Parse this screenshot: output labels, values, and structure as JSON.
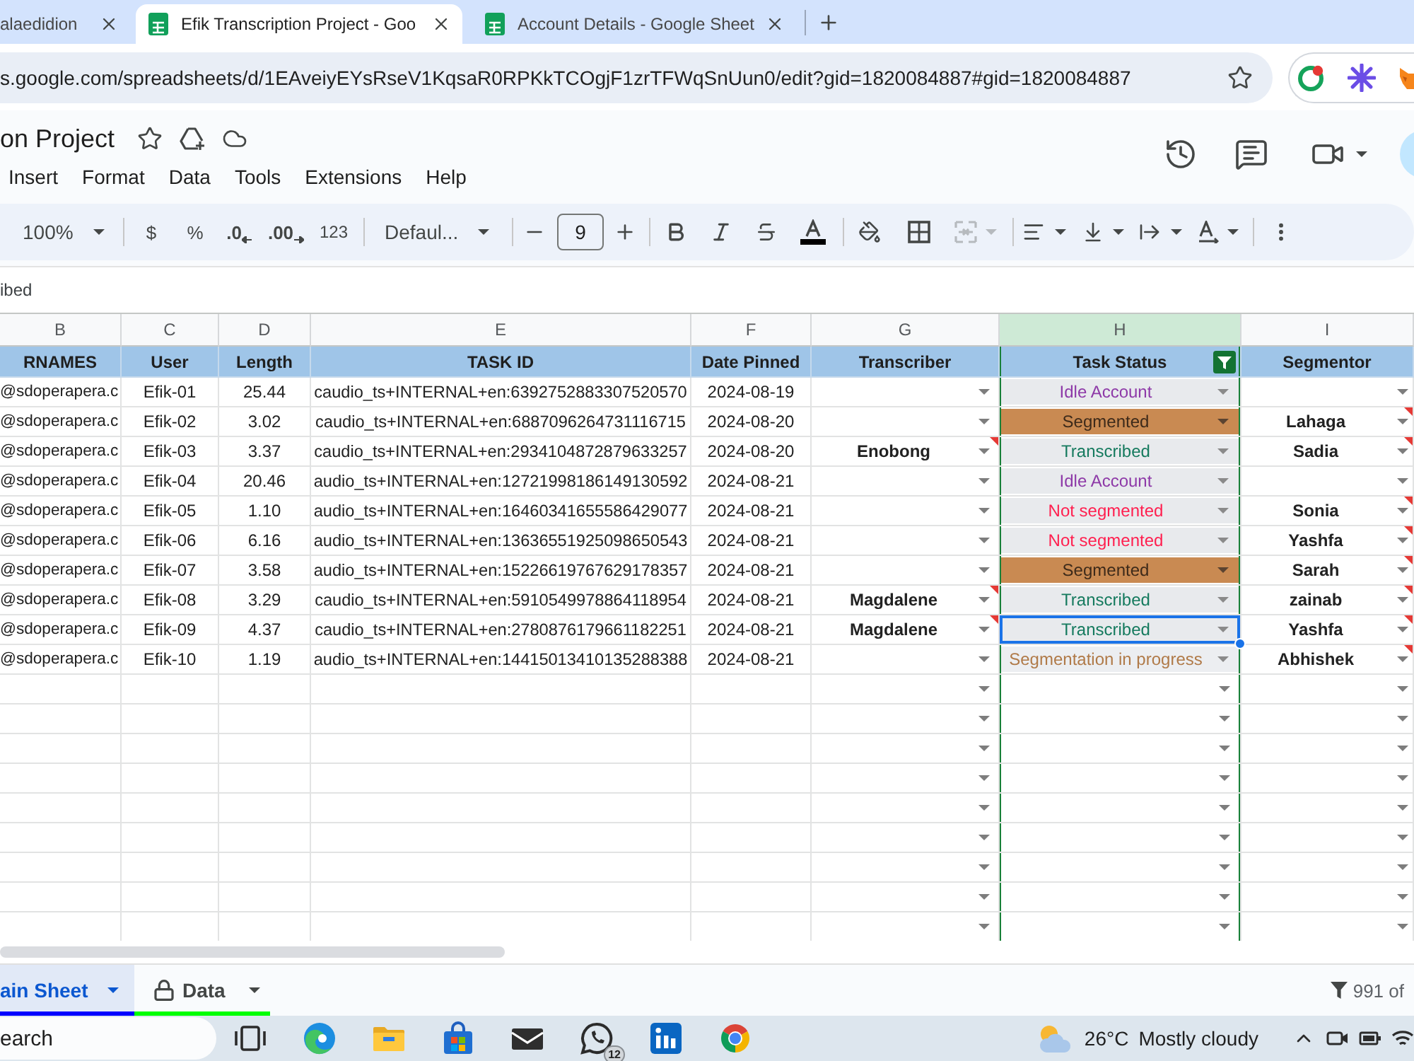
{
  "browser": {
    "tabs": [
      {
        "kind": "plain",
        "title": "alaedidion",
        "selected": false
      },
      {
        "kind": "sheet",
        "title": "Efik Transcription Project - Goo",
        "selected": true
      },
      {
        "kind": "sheet",
        "title": "Account Details - Google Sheet",
        "selected": false
      }
    ],
    "url": "s.google.com/spreadsheets/d/1EAveiyEYsRseV1KqsaR0RPKkTCOgjF1zrTFWqSnUun0/edit?gid=1820084887#gid=1820084887"
  },
  "document": {
    "title": "on Project",
    "menu": [
      "Insert",
      "Format",
      "Data",
      "Tools",
      "Extensions",
      "Help"
    ]
  },
  "toolbar": {
    "zoom": "100%",
    "currency": "$",
    "percent": "%",
    "decimals_less": ".0",
    "decimals_more": ".00",
    "number_format": "123",
    "font": "Defaul...",
    "font_size": "9",
    "merge": {
      "disabled": true
    }
  },
  "formula_bar": {
    "value": "ibed"
  },
  "sheet": {
    "columns": [
      {
        "letter": "B",
        "header": "RNAMES",
        "filtered": false
      },
      {
        "letter": "C",
        "header": "User",
        "filtered": false
      },
      {
        "letter": "D",
        "header": "Length",
        "filtered": false
      },
      {
        "letter": "E",
        "header": "TASK ID",
        "filtered": false
      },
      {
        "letter": "F",
        "header": "Date Pinned",
        "filtered": false
      },
      {
        "letter": "G",
        "header": "Transcriber",
        "filtered": false
      },
      {
        "letter": "H",
        "header": "Task Status",
        "filtered": true
      },
      {
        "letter": "I",
        "header": "Segmentor",
        "filtered": false
      }
    ],
    "rows": [
      {
        "kind": "data",
        "username": "@sdoperapera.c",
        "user": "Efik-01",
        "length": "25.44",
        "task_id": "caudio_ts+INTERNAL+en:6392752883307520570",
        "date_pinned": "2024-08-19",
        "transcriber": {
          "note": false
        },
        "status": {
          "kind": "idle",
          "label": "Idle Account",
          "selected": false
        },
        "segmentor": {
          "note": false
        }
      },
      {
        "kind": "data",
        "username": "@sdoperapera.c",
        "user": "Efik-02",
        "length": "3.02",
        "task_id": "caudio_ts+INTERNAL+en:6887096264731116715",
        "date_pinned": "2024-08-20",
        "transcriber": {
          "note": false
        },
        "status": {
          "kind": "segmented",
          "label": "Segmented",
          "selected": false
        },
        "segmentor": {
          "name": "Lahaga",
          "note": true
        }
      },
      {
        "kind": "data",
        "username": "@sdoperapera.c",
        "user": "Efik-03",
        "length": "3.37",
        "task_id": "caudio_ts+INTERNAL+en:2934104872879633257",
        "date_pinned": "2024-08-20",
        "transcriber": {
          "name": "Enobong",
          "note": true
        },
        "status": {
          "kind": "transcribed",
          "label": "Transcribed",
          "selected": false
        },
        "segmentor": {
          "name": "Sadia",
          "note": true
        }
      },
      {
        "kind": "data",
        "username": "@sdoperapera.c",
        "user": "Efik-04",
        "length": "20.46",
        "task_id": "audio_ts+INTERNAL+en:12721998186149130592",
        "date_pinned": "2024-08-21",
        "transcriber": {
          "note": false
        },
        "status": {
          "kind": "idle",
          "label": "Idle Account",
          "selected": false
        },
        "segmentor": {
          "note": false
        }
      },
      {
        "kind": "data",
        "username": "@sdoperapera.c",
        "user": "Efik-05",
        "length": "1.10",
        "task_id": "audio_ts+INTERNAL+en:16460341655586429077",
        "date_pinned": "2024-08-21",
        "transcriber": {
          "note": false
        },
        "status": {
          "kind": "unsegmented",
          "label": "Not segmented",
          "selected": false
        },
        "segmentor": {
          "name": "Sonia",
          "note": true
        }
      },
      {
        "kind": "data",
        "username": "@sdoperapera.c",
        "user": "Efik-06",
        "length": "6.16",
        "task_id": "audio_ts+INTERNAL+en:13636551925098650543",
        "date_pinned": "2024-08-21",
        "transcriber": {
          "note": false
        },
        "status": {
          "kind": "unsegmented",
          "label": "Not segmented",
          "selected": false
        },
        "segmentor": {
          "name": "Yashfa",
          "note": true
        }
      },
      {
        "kind": "data",
        "username": "@sdoperapera.c",
        "user": "Efik-07",
        "length": "3.58",
        "task_id": "audio_ts+INTERNAL+en:15226619767629178357",
        "date_pinned": "2024-08-21",
        "transcriber": {
          "note": false
        },
        "status": {
          "kind": "segmented",
          "label": "Segmented",
          "selected": false
        },
        "segmentor": {
          "name": "Sarah",
          "note": true
        }
      },
      {
        "kind": "data",
        "username": "@sdoperapera.c",
        "user": "Efik-08",
        "length": "3.29",
        "task_id": "caudio_ts+INTERNAL+en:5910549978864118954",
        "date_pinned": "2024-08-21",
        "transcriber": {
          "name": "Magdalene",
          "note": true
        },
        "status": {
          "kind": "transcribed",
          "label": "Transcribed",
          "selected": false
        },
        "segmentor": {
          "name": "zainab",
          "note": true
        }
      },
      {
        "kind": "data",
        "username": "@sdoperapera.c",
        "user": "Efik-09",
        "length": "4.37",
        "task_id": "caudio_ts+INTERNAL+en:2780876179661182251",
        "date_pinned": "2024-08-21",
        "transcriber": {
          "name": "Magdalene",
          "note": true
        },
        "status": {
          "kind": "transcribed",
          "label": "Transcribed",
          "selected": true
        },
        "segmentor": {
          "name": "Yashfa",
          "note": true
        }
      },
      {
        "kind": "data",
        "username": "@sdoperapera.c",
        "user": "Efik-10",
        "length": "1.19",
        "task_id": "audio_ts+INTERNAL+en:14415013410135288388",
        "date_pinned": "2024-08-21",
        "transcriber": {
          "note": false
        },
        "status": {
          "kind": "progress",
          "label": "Segmentation in progress",
          "selected": false
        },
        "segmentor": {
          "name": "Abhishek",
          "note": true
        }
      },
      {
        "kind": "blank"
      },
      {
        "kind": "blank"
      },
      {
        "kind": "blank"
      },
      {
        "kind": "blank"
      },
      {
        "kind": "blank"
      },
      {
        "kind": "blank"
      },
      {
        "kind": "blank"
      },
      {
        "kind": "blank"
      },
      {
        "kind": "blank"
      }
    ]
  },
  "sheet_tabs": [
    {
      "label": "ain Sheet",
      "selected": true,
      "locked": false,
      "color": "#0000ff"
    },
    {
      "label": "Data",
      "selected": false,
      "locked": true,
      "color": "#00ff00"
    }
  ],
  "filter_status": "991 of",
  "taskbar": {
    "placeholder": "earch",
    "chat_badge": "12",
    "temperature": "26°C",
    "weather": "Mostly cloudy"
  }
}
